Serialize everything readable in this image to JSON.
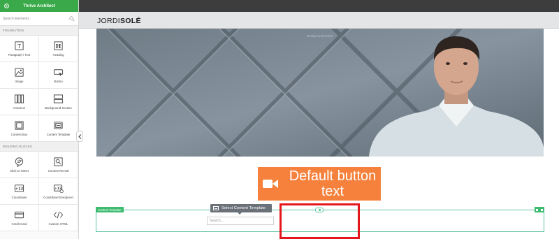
{
  "app": {
    "title": "Thrive Architect"
  },
  "sidebar": {
    "search_placeholder": "Search Elements",
    "sections": [
      {
        "title": "FOUNDATION",
        "items": [
          {
            "label": "Paragraph / Text",
            "icon": "paragraph-icon"
          },
          {
            "label": "Heading",
            "icon": "heading-icon"
          },
          {
            "label": "Image",
            "icon": "image-icon"
          },
          {
            "label": "Button",
            "icon": "button-icon"
          },
          {
            "label": "Columns",
            "icon": "columns-icon"
          },
          {
            "label": "Background Section",
            "icon": "background-section-icon"
          },
          {
            "label": "Content Box",
            "icon": "content-box-icon"
          },
          {
            "label": "Content Template",
            "icon": "content-template-icon"
          }
        ]
      },
      {
        "title": "BUILDING BLOCKS",
        "items": [
          {
            "label": "Click to Tweet",
            "icon": "twitter-icon"
          },
          {
            "label": "Content Reveal",
            "icon": "content-reveal-icon"
          },
          {
            "label": "Countdown",
            "icon": "countdown-icon"
          },
          {
            "label": "Countdown Evergreen",
            "icon": "countdown-evergreen-icon"
          },
          {
            "label": "Credit Card",
            "icon": "credit-card-icon"
          },
          {
            "label": "Custom HTML",
            "icon": "code-icon"
          }
        ]
      }
    ]
  },
  "page": {
    "logo_light": "JORDI",
    "logo_bold": "SOLÉ",
    "hero_caption": "Background section",
    "cta_label": "Default button text",
    "content_template_tag": "Content Template",
    "select_button_label": "Select Content Template",
    "template_search_placeholder": "Search..."
  },
  "colors": {
    "brand_green": "#3aa94a",
    "cta_orange": "#f5813d",
    "highlight_red": "#e5161c",
    "template_border": "#5fc3a8"
  }
}
